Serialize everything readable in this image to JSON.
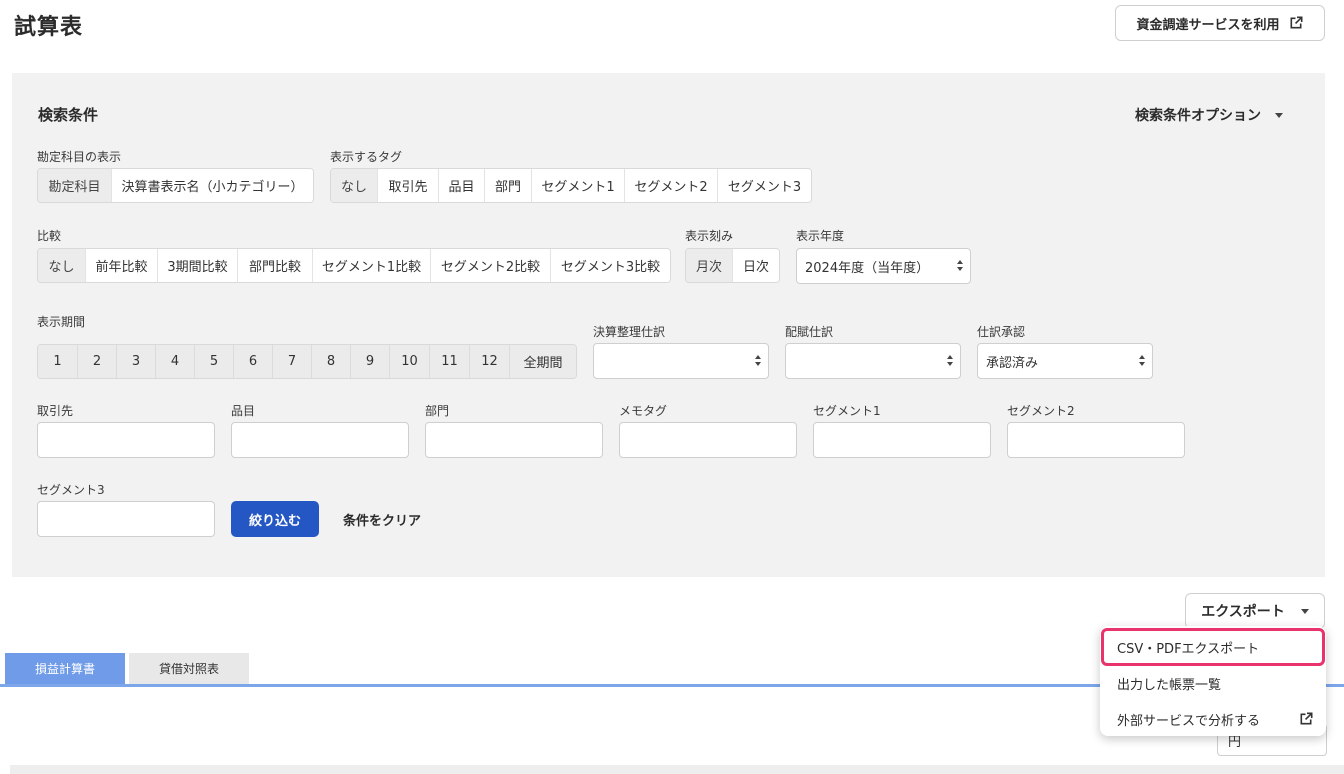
{
  "header": {
    "title": "試算表",
    "funding_button": "資金調達サービスを利用"
  },
  "search": {
    "title": "検索条件",
    "options_label": "検索条件オプション",
    "account_display": {
      "label": "勘定科目の表示",
      "options": [
        "勘定科目",
        "決算書表示名（小カテゴリー）"
      ]
    },
    "tags": {
      "label": "表示するタグ",
      "options": [
        "なし",
        "取引先",
        "品目",
        "部門",
        "セグメント1",
        "セグメント2",
        "セグメント3"
      ]
    },
    "compare": {
      "label": "比較",
      "options": [
        "なし",
        "前年比較",
        "3期間比較",
        "部門比較",
        "セグメント1比較",
        "セグメント2比較",
        "セグメント3比較"
      ]
    },
    "interval": {
      "label": "表示刻み",
      "options": [
        "月次",
        "日次"
      ]
    },
    "fiscal_year": {
      "label": "表示年度",
      "value": "2024年度（当年度）"
    },
    "period": {
      "label": "表示期間",
      "options": [
        "1",
        "2",
        "3",
        "4",
        "5",
        "6",
        "7",
        "8",
        "9",
        "10",
        "11",
        "12",
        "全期間"
      ]
    },
    "closing_entries": {
      "label": "決算整理仕訳",
      "value": ""
    },
    "allocation_entries": {
      "label": "配賦仕訳",
      "value": ""
    },
    "approval": {
      "label": "仕訳承認",
      "value": "承認済み"
    },
    "partner": {
      "label": "取引先"
    },
    "item": {
      "label": "品目"
    },
    "department": {
      "label": "部門"
    },
    "memo_tag": {
      "label": "メモタグ"
    },
    "segment1": {
      "label": "セグメント1"
    },
    "segment2": {
      "label": "セグメント2"
    },
    "segment3": {
      "label": "セグメント3"
    },
    "filter_button": "絞り込む",
    "clear_button": "条件をクリア"
  },
  "export": {
    "button": "エクスポート",
    "menu": [
      "CSV・PDFエクスポート",
      "出力した帳票一覧",
      "外部サービスで分析する"
    ]
  },
  "tabs": [
    "損益計算書",
    "貸借対照表"
  ],
  "unit_select": {
    "value": "円"
  },
  "colors": {
    "primary": "#2557c4",
    "tab_active": "#6f9be8",
    "highlight": "#e8336c"
  }
}
